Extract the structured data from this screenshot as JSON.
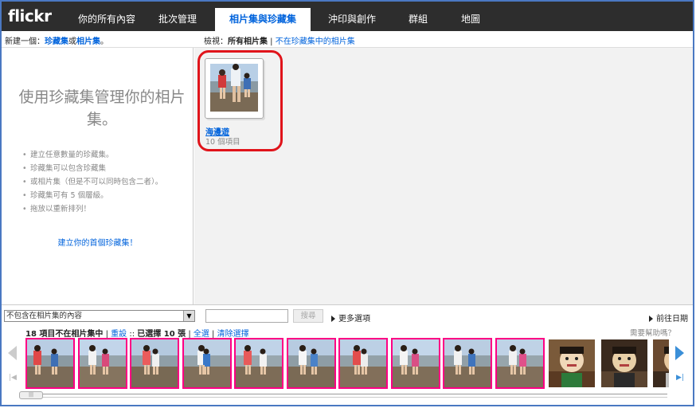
{
  "nav": {
    "logo": "flickr",
    "tabs": [
      {
        "label": "你的所有內容"
      },
      {
        "label": "批次管理"
      },
      {
        "label": "相片集與珍藏集",
        "active": true
      },
      {
        "label": "沖印與創作"
      },
      {
        "label": "群組"
      },
      {
        "label": "地圖"
      }
    ]
  },
  "subbar": {
    "new_prefix": "新建一個：",
    "new_collection": "珍藏集",
    "new_or": "或",
    "new_set": "相片集",
    "new_suffix": "。",
    "view_prefix": "檢視：",
    "view_all_sets": "所有相片集",
    "view_separator": " | ",
    "view_not_in_collection": "不在珍藏集中的相片集"
  },
  "left_panel": {
    "title": "使用珍藏集管理你的相片集。",
    "tips": [
      "建立任意數量的珍藏集。",
      "珍藏集可以包含珍藏集",
      "或相片集（但是不可以同時包含二者）。",
      "珍藏集可有 5 個層級。",
      "拖放以重新排列！"
    ],
    "create_link": "建立你的首個珍藏集！"
  },
  "set": {
    "name": "海邊遊",
    "count": "10 個項目"
  },
  "filter": {
    "select_value": "不包含在相片集的內容",
    "search_button": "搜尋",
    "more_options": "更多選項",
    "goto_date": "前往日期"
  },
  "strip_info": {
    "count_text": "18 項目不在相片集中",
    "sep1": " | ",
    "reset": "重設",
    "sep2": " :: ",
    "selected_prefix": "已選擇 ",
    "selected_count": "10",
    "selected_suffix": " 張",
    "sep3": " | ",
    "select_all": "全選",
    "sep4": " | ",
    "clear": "清除選擇",
    "help": "需要幫助嗎？"
  },
  "thumbs": [
    {
      "selected": true
    },
    {
      "selected": true
    },
    {
      "selected": true
    },
    {
      "selected": true
    },
    {
      "selected": true
    },
    {
      "selected": true
    },
    {
      "selected": true
    },
    {
      "selected": true
    },
    {
      "selected": true
    },
    {
      "selected": true
    },
    {
      "selected": false
    },
    {
      "selected": false
    },
    {
      "selected": false
    }
  ],
  "colors": {
    "nav_bg": "#2d2d2d",
    "link_blue": "#0063dc",
    "highlight_red": "#e0141b",
    "selected_pink": "#ff0084",
    "frame_blue": "#4a78c2"
  }
}
